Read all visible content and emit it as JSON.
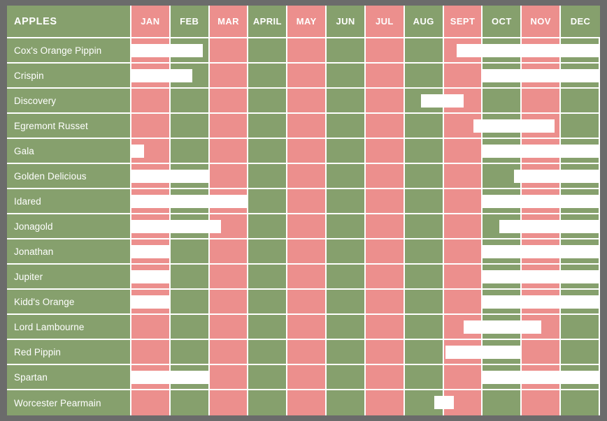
{
  "colors": {
    "background": "#6b6b6b",
    "odd_month": "#ec8f8d",
    "even_month": "#86a06d",
    "label_cell": "#86a06d",
    "bar": "#ffffff",
    "grid_line": "#ffffff",
    "text": "#ffffff"
  },
  "header": {
    "title": "APPLES",
    "months": [
      "JAN",
      "FEB",
      "MAR",
      "APRIL",
      "MAY",
      "JUN",
      "JUL",
      "AUG",
      "SEPT",
      "OCT",
      "NOV",
      "DEC"
    ]
  },
  "chart_data": {
    "type": "bar",
    "title": "APPLES",
    "xlabel": "",
    "ylabel": "",
    "categories": [
      "JAN",
      "FEB",
      "MAR",
      "APRIL",
      "MAY",
      "JUN",
      "JUL",
      "AUG",
      "SEPT",
      "OCT",
      "NOV",
      "DEC"
    ],
    "legend_position": "none",
    "grid": true,
    "note": "Gantt-style availability chart. Each row is an apple variety; white bars mark the months it is available. Bar ranges are given in fractional month units where 0 = start of JAN and 12 = end of DEC.",
    "series": [
      {
        "name": "Cox's Orange Pippin",
        "spans": [
          [
            0.0,
            1.83
          ],
          [
            8.33,
            12.0
          ]
        ]
      },
      {
        "name": "Crispin",
        "spans": [
          [
            0.0,
            1.55
          ],
          [
            9.0,
            12.0
          ]
        ]
      },
      {
        "name": "Discovery",
        "spans": [
          [
            7.42,
            8.5
          ]
        ]
      },
      {
        "name": "Egremont Russet",
        "spans": [
          [
            8.75,
            10.83
          ]
        ]
      },
      {
        "name": "Gala",
        "spans": [
          [
            0.0,
            0.33
          ],
          [
            9.0,
            12.0
          ]
        ]
      },
      {
        "name": "Golden Delicious",
        "spans": [
          [
            0.0,
            2.0
          ],
          [
            9.8,
            12.0
          ]
        ]
      },
      {
        "name": "Idared",
        "spans": [
          [
            0.0,
            3.0
          ],
          [
            9.0,
            12.0
          ]
        ]
      },
      {
        "name": "Jonagold",
        "spans": [
          [
            0.0,
            2.3
          ],
          [
            9.42,
            12.0
          ]
        ]
      },
      {
        "name": "Jonathan",
        "spans": [
          [
            0.0,
            1.0
          ],
          [
            9.0,
            12.0
          ]
        ]
      },
      {
        "name": "Jupiter",
        "spans": [
          [
            0.0,
            1.0
          ],
          [
            9.0,
            12.0
          ]
        ]
      },
      {
        "name": "Kidd's Orange",
        "spans": [
          [
            0.0,
            1.0
          ],
          [
            9.0,
            12.0
          ]
        ]
      },
      {
        "name": "Lord Lambourne",
        "spans": [
          [
            8.5,
            10.5
          ]
        ]
      },
      {
        "name": "Red Pippin",
        "spans": [
          [
            8.05,
            10.0
          ]
        ]
      },
      {
        "name": "Spartan",
        "spans": [
          [
            0.0,
            2.0
          ],
          [
            9.0,
            12.0
          ]
        ]
      },
      {
        "name": "Worcester Pearmain",
        "spans": [
          [
            7.75,
            8.25
          ]
        ]
      }
    ]
  },
  "rows": [
    {
      "label": "Cox's Orange Pippin"
    },
    {
      "label": "Crispin"
    },
    {
      "label": "Discovery"
    },
    {
      "label": "Egremont Russet"
    },
    {
      "label": "Gala"
    },
    {
      "label": "Golden Delicious"
    },
    {
      "label": "Idared"
    },
    {
      "label": "Jonagold"
    },
    {
      "label": "Jonathan"
    },
    {
      "label": "Jupiter"
    },
    {
      "label": "Kidd's Orange"
    },
    {
      "label": "Lord Lambourne"
    },
    {
      "label": "Red Pippin"
    },
    {
      "label": "Spartan"
    },
    {
      "label": "Worcester Pearmain"
    }
  ]
}
